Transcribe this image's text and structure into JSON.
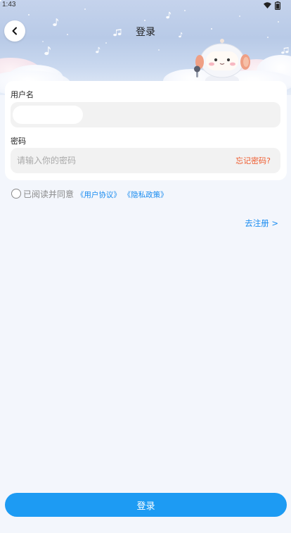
{
  "status_bar": {
    "time": "1:43",
    "icons": [
      "wifi-icon",
      "battery-icon"
    ]
  },
  "header": {
    "title": "登录",
    "back_icon": "chevron-left-icon"
  },
  "form": {
    "username": {
      "label": "用户名",
      "value": ""
    },
    "password": {
      "label": "密码",
      "value": "",
      "placeholder": "请输入你的密码",
      "forgot_label": "忘记密码?"
    }
  },
  "agreement": {
    "checked": false,
    "prefix": "已阅读并同意",
    "terms_link": "《用户协议》",
    "privacy_link": "《隐私政策》"
  },
  "register_link": "去注册 >",
  "submit_label": "登录",
  "colors": {
    "accent": "#1d9bf3",
    "link": "#1a8cf0",
    "forgot": "#ef5a2c",
    "page_bg": "#f3f6fc",
    "input_bg": "#f2f2f2"
  }
}
